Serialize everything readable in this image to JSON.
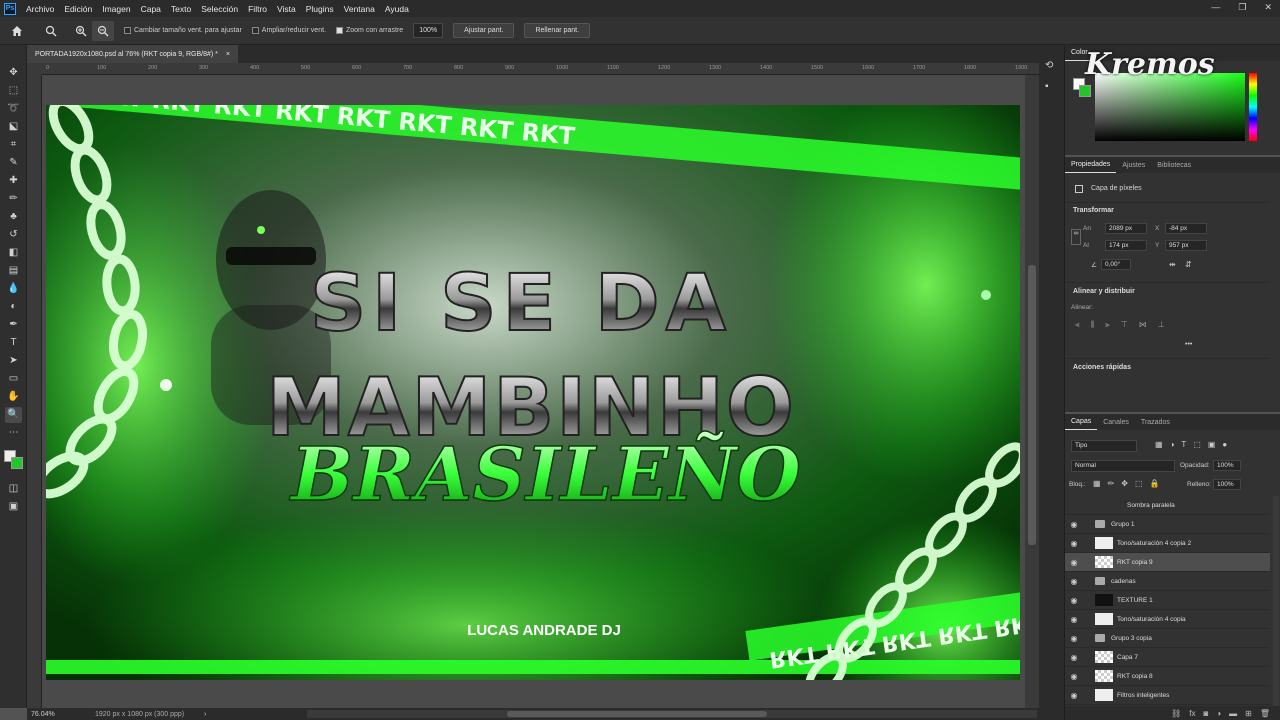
{
  "app": {
    "logo": "Ps"
  },
  "menu": [
    "Archivo",
    "Edición",
    "Imagen",
    "Capa",
    "Texto",
    "Selección",
    "Filtro",
    "Vista",
    "Plugins",
    "Ventana",
    "Ayuda"
  ],
  "window_controls": {
    "minimize": "—",
    "restore": "❐",
    "close": "✕"
  },
  "options": {
    "resize_windows": "Cambiar tamaño vent. para ajustar",
    "zoom_all": "Ampliar/reducir vent.",
    "scrubby_zoom": "Zoom con arrastre",
    "zoom_value": "100%",
    "fit_button": "Ajustar pant.",
    "fill_button": "Rellenar pant."
  },
  "document": {
    "tab_title": "PORTADA1920x1080.psd al 76% (RKT copia 9, RGB/8#) *",
    "close": "×"
  },
  "ruler_ticks": [
    "0",
    "100",
    "200",
    "300",
    "400",
    "500",
    "600",
    "700",
    "800",
    "900",
    "1000",
    "1100",
    "1200",
    "1300",
    "1400",
    "1500",
    "1600",
    "1700",
    "1800",
    "1900"
  ],
  "artwork": {
    "line1": "SI SE DA",
    "line2": "MAMBINHO",
    "line3": "BRASILEÑO",
    "credit": "LUCAS ANDRADE DJ",
    "band_text": "RKT RKT RKT RKT RKT RKT RKT RKT RKT",
    "band_text_rev": "RKT RKT RKT RKT RKT RKT RKT",
    "watermark": "Kremos"
  },
  "status": {
    "zoom": "76.04%",
    "size": "1920 px x 1080 px (300 ppp)",
    "arrow": "›"
  },
  "color_panel": {
    "tab": "Color"
  },
  "properties": {
    "tabs": [
      "Propiedades",
      "Ajustes",
      "Bibliotecas"
    ],
    "layer_type": "Capa de píxeles",
    "transform_title": "Transformar",
    "w_label": "An",
    "w": "2089 px",
    "h_label": "Al",
    "h": "174 px",
    "x_label": "X",
    "x": "-84 px",
    "y_label": "Y",
    "y": "957 px",
    "angle": "0,00°",
    "align_title": "Alinear y distribuir",
    "align_label": "Alinear:",
    "quick_title": "Acciones rápidas",
    "more": "•••"
  },
  "layers": {
    "tabs": [
      "Capas",
      "Canales",
      "Trazados"
    ],
    "kind": "Tipo",
    "blend": "Normal",
    "opacity_label": "Opacidad:",
    "opacity": "100%",
    "lock_label": "Bloq.:",
    "fill_label": "Relleno:",
    "fill": "100%",
    "rows": [
      {
        "name": "Sombra paralela",
        "kind": "effect"
      },
      {
        "name": "Grupo 1",
        "kind": "folder"
      },
      {
        "name": "Tono/saturación 4 copia 2",
        "kind": "adjust"
      },
      {
        "name": "RKT copia 9",
        "kind": "pixel",
        "selected": true
      },
      {
        "name": "cadenas",
        "kind": "folder"
      },
      {
        "name": "TEXTURE 1",
        "kind": "dark"
      },
      {
        "name": "Tono/saturación 4 copia",
        "kind": "adjust"
      },
      {
        "name": "Grupo 3 copia",
        "kind": "folder"
      },
      {
        "name": "Capa 7",
        "kind": "pixel"
      },
      {
        "name": "RKT copia 8",
        "kind": "pixel"
      },
      {
        "name": "Filtros inteligentes",
        "kind": "adjust"
      }
    ]
  },
  "colors": {
    "accent": "#31a8ff",
    "neon_green": "#39ff3a",
    "dark_green": "#0a5a0a",
    "selection": "#4e4e4e"
  }
}
